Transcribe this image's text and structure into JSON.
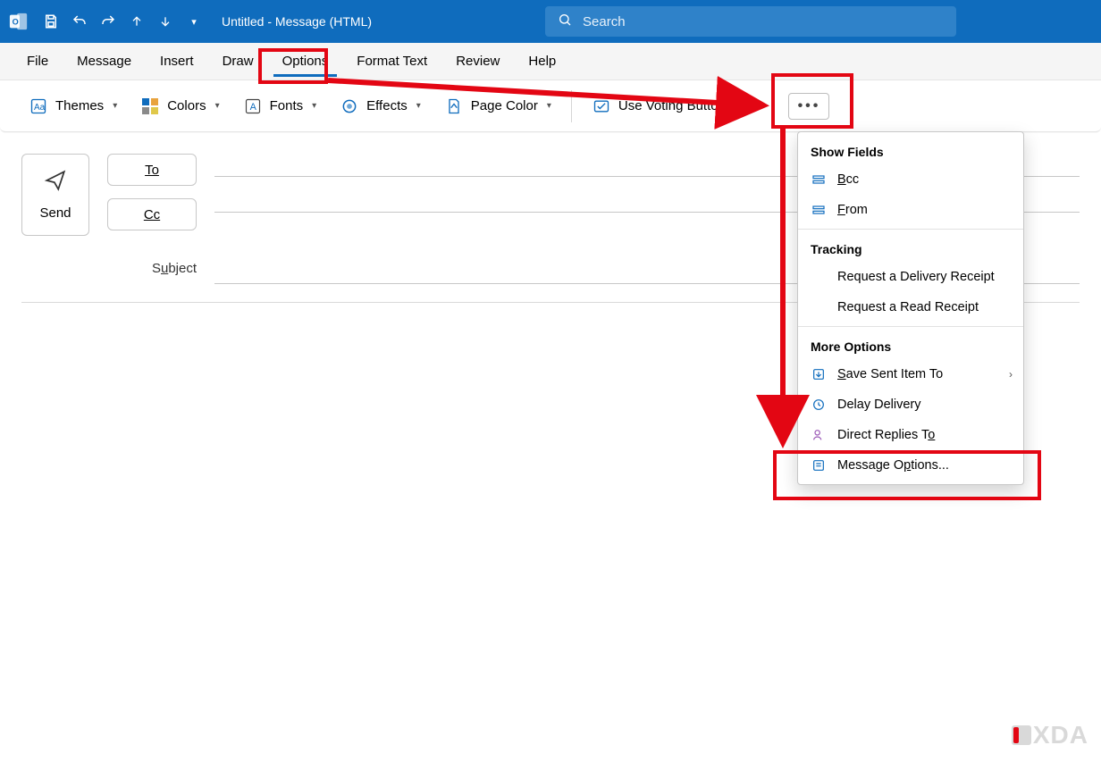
{
  "title": "Untitled  -  Message (HTML)",
  "search": {
    "placeholder": "Search"
  },
  "tabs": {
    "file": "File",
    "message": "Message",
    "insert": "Insert",
    "draw": "Draw",
    "options": "Options",
    "format": "Format Text",
    "review": "Review",
    "help": "Help"
  },
  "ribbon": {
    "themes": "Themes",
    "colors": "Colors",
    "fonts": "Fonts",
    "effects": "Effects",
    "pagecolor": "Page Color",
    "voting": "Use Voting Buttons"
  },
  "compose": {
    "send": "Send",
    "to_label": "To",
    "cc_label": "Cc",
    "subject_label": "Subject",
    "to_value": "",
    "cc_value": "",
    "subject_value": ""
  },
  "menu": {
    "section1": "Show Fields",
    "bcc": "Bcc",
    "from": "From",
    "section2": "Tracking",
    "delivery": "Request a Delivery Receipt",
    "read": "Request a Read Receipt",
    "section3": "More Options",
    "savesent": "Save Sent Item To",
    "delay": "Delay Delivery",
    "direct": "Direct Replies To",
    "msgopt": "Message Options..."
  },
  "watermark": "XDA"
}
